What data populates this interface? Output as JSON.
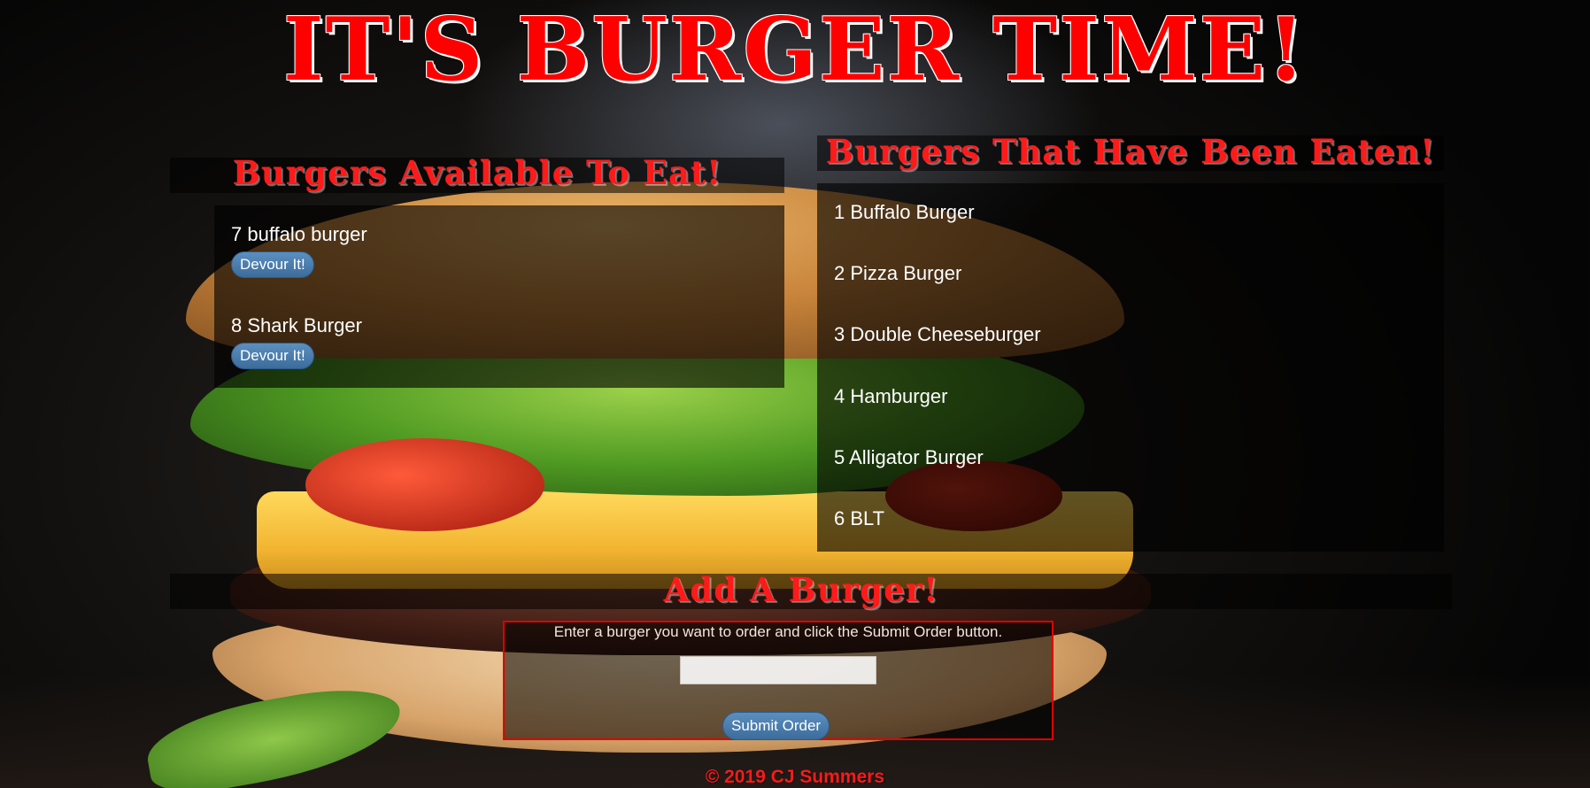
{
  "header": {
    "title": "IT'S BURGER TIME!"
  },
  "available": {
    "heading": "Burgers Available To Eat!",
    "items": [
      {
        "label": "7 buffalo burger",
        "button_label": "Devour It!"
      },
      {
        "label": "8 Shark Burger",
        "button_label": "Devour It!"
      }
    ]
  },
  "eaten": {
    "heading": "Burgers That Have Been Eaten!",
    "items": [
      {
        "label": "1 Buffalo Burger"
      },
      {
        "label": "2 Pizza Burger"
      },
      {
        "label": "3 Double Cheeseburger"
      },
      {
        "label": "4 Hamburger"
      },
      {
        "label": "5 Alligator Burger"
      },
      {
        "label": "6 BLT"
      }
    ]
  },
  "add_form": {
    "heading": "Add A Burger!",
    "instructions": "Enter a burger you want to order and click the Submit Order button.",
    "input_value": "",
    "input_placeholder": "",
    "submit_label": "Submit Order"
  },
  "footer": {
    "text": "© 2019 CJ Summers"
  },
  "colors": {
    "title_red": "#ff0000",
    "button_blue": "#3b6c9c",
    "form_border": "#e00000"
  }
}
